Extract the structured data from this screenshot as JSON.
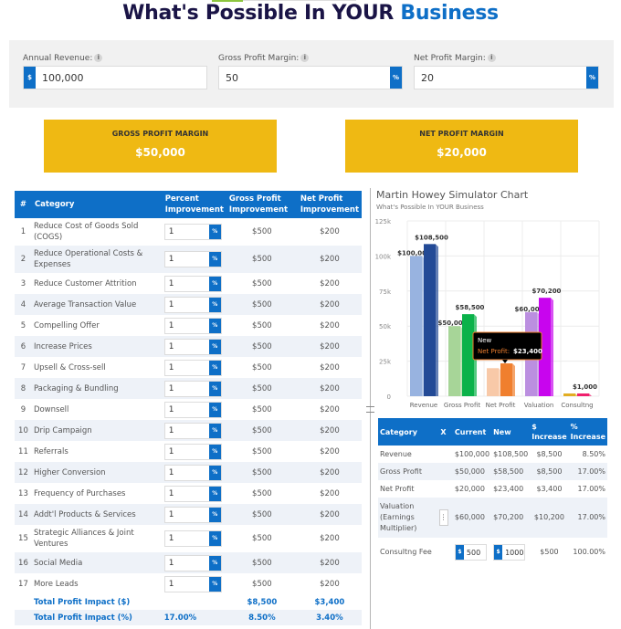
{
  "header": {
    "title_main": "What's Possible In YOUR ",
    "title_accent": "Business"
  },
  "inputs": {
    "annual_revenue": {
      "label": "Annual Revenue:",
      "prefix": "$",
      "value": "100,000"
    },
    "gross_profit_margin": {
      "label": "Gross Profit Margin:",
      "suffix": "%",
      "value": "50"
    },
    "net_profit_margin": {
      "label": "Net Profit Margin:",
      "suffix": "%",
      "value": "20"
    },
    "info_icon": "i"
  },
  "summary": {
    "gross": {
      "label": "GROSS PROFIT MARGIN",
      "value": "$50,000"
    },
    "net": {
      "label": "NET PROFIT MARGIN",
      "value": "$20,000"
    }
  },
  "improvements": {
    "headers": {
      "num": "#",
      "category": "Category",
      "percent": "Percent Improvement",
      "gross": "Gross Profit Improvement",
      "net": "Net Profit Improvement"
    },
    "pct_suffix": "%",
    "rows": [
      {
        "num": "1",
        "category": "Reduce Cost of Goods Sold (COGS)",
        "percent": "1",
        "gross": "$500",
        "net": "$200"
      },
      {
        "num": "2",
        "category": "Reduce Operational Costs & Expenses",
        "percent": "1",
        "gross": "$500",
        "net": "$200"
      },
      {
        "num": "3",
        "category": "Reduce Customer Attrition",
        "percent": "1",
        "gross": "$500",
        "net": "$200"
      },
      {
        "num": "4",
        "category": "Average Transaction Value",
        "percent": "1",
        "gross": "$500",
        "net": "$200"
      },
      {
        "num": "5",
        "category": "Compelling Offer",
        "percent": "1",
        "gross": "$500",
        "net": "$200"
      },
      {
        "num": "6",
        "category": "Increase Prices",
        "percent": "1",
        "gross": "$500",
        "net": "$200"
      },
      {
        "num": "7",
        "category": "Upsell & Cross-sell",
        "percent": "1",
        "gross": "$500",
        "net": "$200"
      },
      {
        "num": "8",
        "category": "Packaging & Bundling",
        "percent": "1",
        "gross": "$500",
        "net": "$200"
      },
      {
        "num": "9",
        "category": "Downsell",
        "percent": "1",
        "gross": "$500",
        "net": "$200"
      },
      {
        "num": "10",
        "category": "Drip Campaign",
        "percent": "1",
        "gross": "$500",
        "net": "$200"
      },
      {
        "num": "11",
        "category": "Referrals",
        "percent": "1",
        "gross": "$500",
        "net": "$200"
      },
      {
        "num": "12",
        "category": "Higher Conversion",
        "percent": "1",
        "gross": "$500",
        "net": "$200"
      },
      {
        "num": "13",
        "category": "Frequency of Purchases",
        "percent": "1",
        "gross": "$500",
        "net": "$200"
      },
      {
        "num": "14",
        "category": "Addt'l Products & Services",
        "percent": "1",
        "gross": "$500",
        "net": "$200"
      },
      {
        "num": "15",
        "category": "Strategic Alliances & Joint Ventures",
        "percent": "1",
        "gross": "$500",
        "net": "$200"
      },
      {
        "num": "16",
        "category": "Social Media",
        "percent": "1",
        "gross": "$500",
        "net": "$200"
      },
      {
        "num": "17",
        "category": "More Leads",
        "percent": "1",
        "gross": "$500",
        "net": "$200"
      }
    ],
    "totals": [
      {
        "label": "Total Profit Impact ($)",
        "percent": "",
        "gross": "$8,500",
        "net": "$3,400"
      },
      {
        "label": "Total Profit Impact (%)",
        "percent": "17.00%",
        "gross": "8.50%",
        "net": "3.40%"
      }
    ]
  },
  "chart": {
    "title": "Martin Howey Simulator Chart",
    "subtitle": "What's Possible In YOUR Business",
    "tooltip": {
      "series": "New",
      "label": "Net Profit:",
      "value": "$23,400"
    }
  },
  "chart_data": {
    "type": "bar",
    "title": "Martin Howey Simulator Chart",
    "subtitle": "What's Possible In YOUR Business",
    "categories": [
      "Revenue",
      "Gross Profit",
      "Net Profit",
      "Valuation",
      "Consultng"
    ],
    "series": [
      {
        "name": "Current",
        "values": [
          100000,
          50000,
          20000,
          60000,
          500
        ],
        "colors": [
          "#98b3e0",
          "#a7d598",
          "#f8c9a8",
          "#bb8fe0",
          "#e2ad22"
        ]
      },
      {
        "name": "New",
        "values": [
          108500,
          58500,
          23400,
          70200,
          1000
        ],
        "colors": [
          "#234a96",
          "#0bb24a",
          "#f07f2e",
          "#c805ee",
          "#f0206e"
        ]
      }
    ],
    "data_labels": {
      "Current": [
        "$100,000",
        "$50,000",
        "",
        "$60,000",
        ""
      ],
      "New": [
        "$108,500",
        "$58,500",
        "",
        "$70,200",
        "$1,000"
      ]
    },
    "yticks": [
      "0",
      "25k",
      "50k",
      "75k",
      "100k",
      "125k"
    ],
    "ylim": [
      0,
      125000
    ],
    "grid": true,
    "legend": "none"
  },
  "results": {
    "headers": {
      "category": "Category",
      "x": "X",
      "current": "Current",
      "new": "New",
      "dollar_increase": "$ Increase",
      "pct_increase": "% Increase"
    },
    "rows": [
      {
        "category": "Revenue",
        "current": "$100,000",
        "new": "$108,500",
        "dollar": "$8,500",
        "pct": "8.50%"
      },
      {
        "category": "Gross Profit",
        "current": "$50,000",
        "new": "$58,500",
        "dollar": "$8,500",
        "pct": "17.00%"
      },
      {
        "category": "Net Profit",
        "current": "$20,000",
        "new": "$23,400",
        "dollar": "$3,400",
        "pct": "17.00%"
      },
      {
        "category": "Valuation (Earnings Multiplier)",
        "x_button": "⋮",
        "current": "$60,000",
        "new": "$70,200",
        "dollar": "$10,200",
        "pct": "17.00%"
      }
    ],
    "fee": {
      "category": "Consultng Fee",
      "prefix": "$",
      "current": "500",
      "new": "1000",
      "dollar": "$500",
      "pct": "100.00%"
    }
  }
}
